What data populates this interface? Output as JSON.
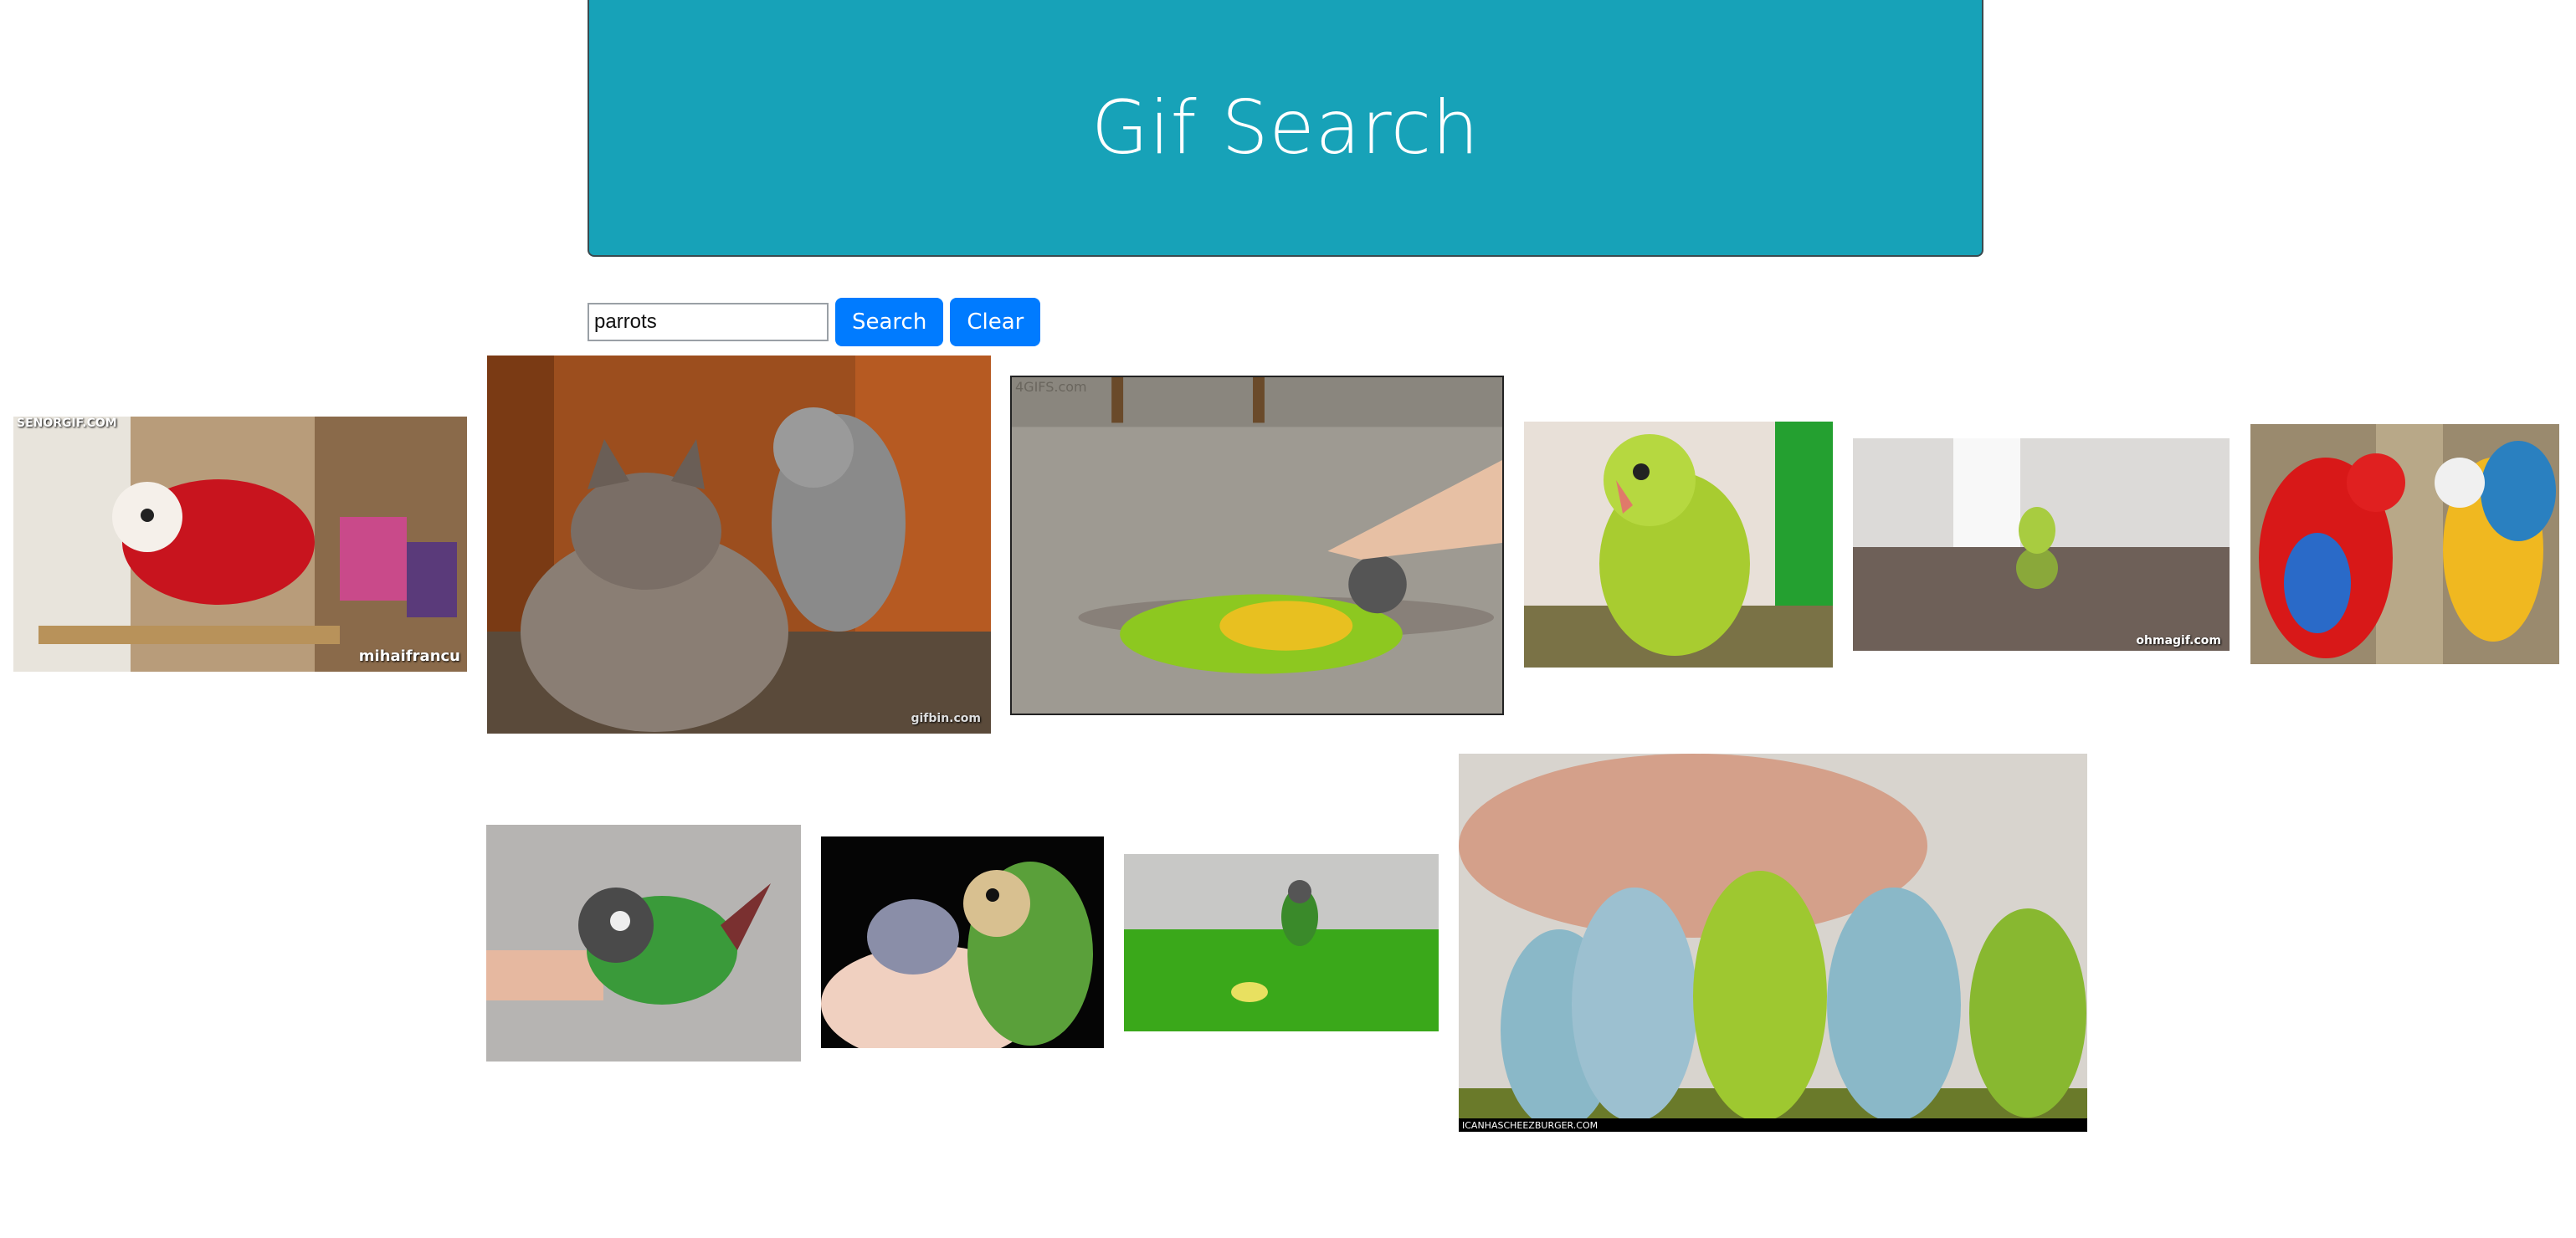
{
  "header": {
    "title": "Gif Search"
  },
  "search": {
    "value": "parrots",
    "search_label": "Search",
    "clear_label": "Clear"
  },
  "gifs": [
    {
      "id": 1,
      "watermark_top": "SENORGIF.COM",
      "watermark": "mihaifrancu"
    },
    {
      "id": 2,
      "watermark": "gifbin.com"
    },
    {
      "id": 3,
      "watermark": "4GIFS.com"
    },
    {
      "id": 4
    },
    {
      "id": 5,
      "watermark": "ohmagif.com"
    },
    {
      "id": 6
    },
    {
      "id": 7
    },
    {
      "id": 8
    },
    {
      "id": 9
    },
    {
      "id": 10,
      "watermark": "ICANHASCHEEZBURGER.COM"
    }
  ],
  "colors": {
    "header_bg": "#17a2b8",
    "button_bg": "#007bff"
  }
}
